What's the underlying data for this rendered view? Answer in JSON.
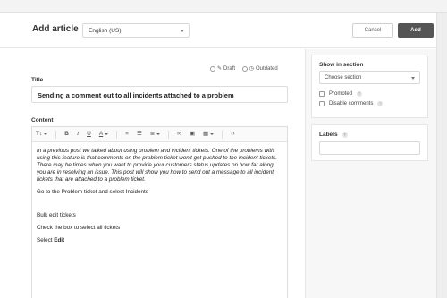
{
  "header": {
    "title": "Add article",
    "language": "English (US)",
    "cancel_label": "Cancel",
    "add_label": "Add"
  },
  "status": {
    "draft_label": "Draft",
    "outdated_label": "Outdated"
  },
  "title_field": {
    "label": "Title",
    "value": "Sending a comment out to all incidents attached to a problem"
  },
  "content_field": {
    "label": "Content"
  },
  "toolbar": {
    "items": [
      {
        "name": "text-size-icon",
        "glyph": "T↕"
      },
      {
        "name": "bold-icon",
        "glyph": "B"
      },
      {
        "name": "italic-icon",
        "glyph": "I"
      },
      {
        "name": "underline-icon",
        "glyph": "U"
      },
      {
        "name": "text-color-icon",
        "glyph": "A"
      },
      {
        "name": "ordered-list-icon",
        "glyph": "≡"
      },
      {
        "name": "bullet-list-icon",
        "glyph": "☰"
      },
      {
        "name": "align-icon",
        "glyph": "≣"
      },
      {
        "name": "link-icon",
        "glyph": "∞"
      },
      {
        "name": "image-icon",
        "glyph": "▣"
      },
      {
        "name": "table-icon",
        "glyph": "▦"
      },
      {
        "name": "code-icon",
        "glyph": "‹›"
      }
    ]
  },
  "content": {
    "intro": "In a previous post we talked about using problem and incident tickets. One of the problems with using this feature is that comments on the problem ticket won't get pushed to the incident tickets. There may be times when you want to provide your customers status updates on how far along you are in resolving an issue. This post will show you how to send out a message to all incident tickets that are attached to a problem ticket.",
    "step1": "Go to the Problem ticket and select Incidents",
    "step2": "Bulk edit tickets",
    "step3": "Check the box to select all tickets",
    "step4_prefix": "Select ",
    "step4_bold": "Edit"
  },
  "sidebar": {
    "section_label": "Show in section",
    "section_select": "Choose section",
    "promoted_label": "Promoted",
    "disable_comments_label": "Disable comments",
    "labels_label": "Labels"
  }
}
